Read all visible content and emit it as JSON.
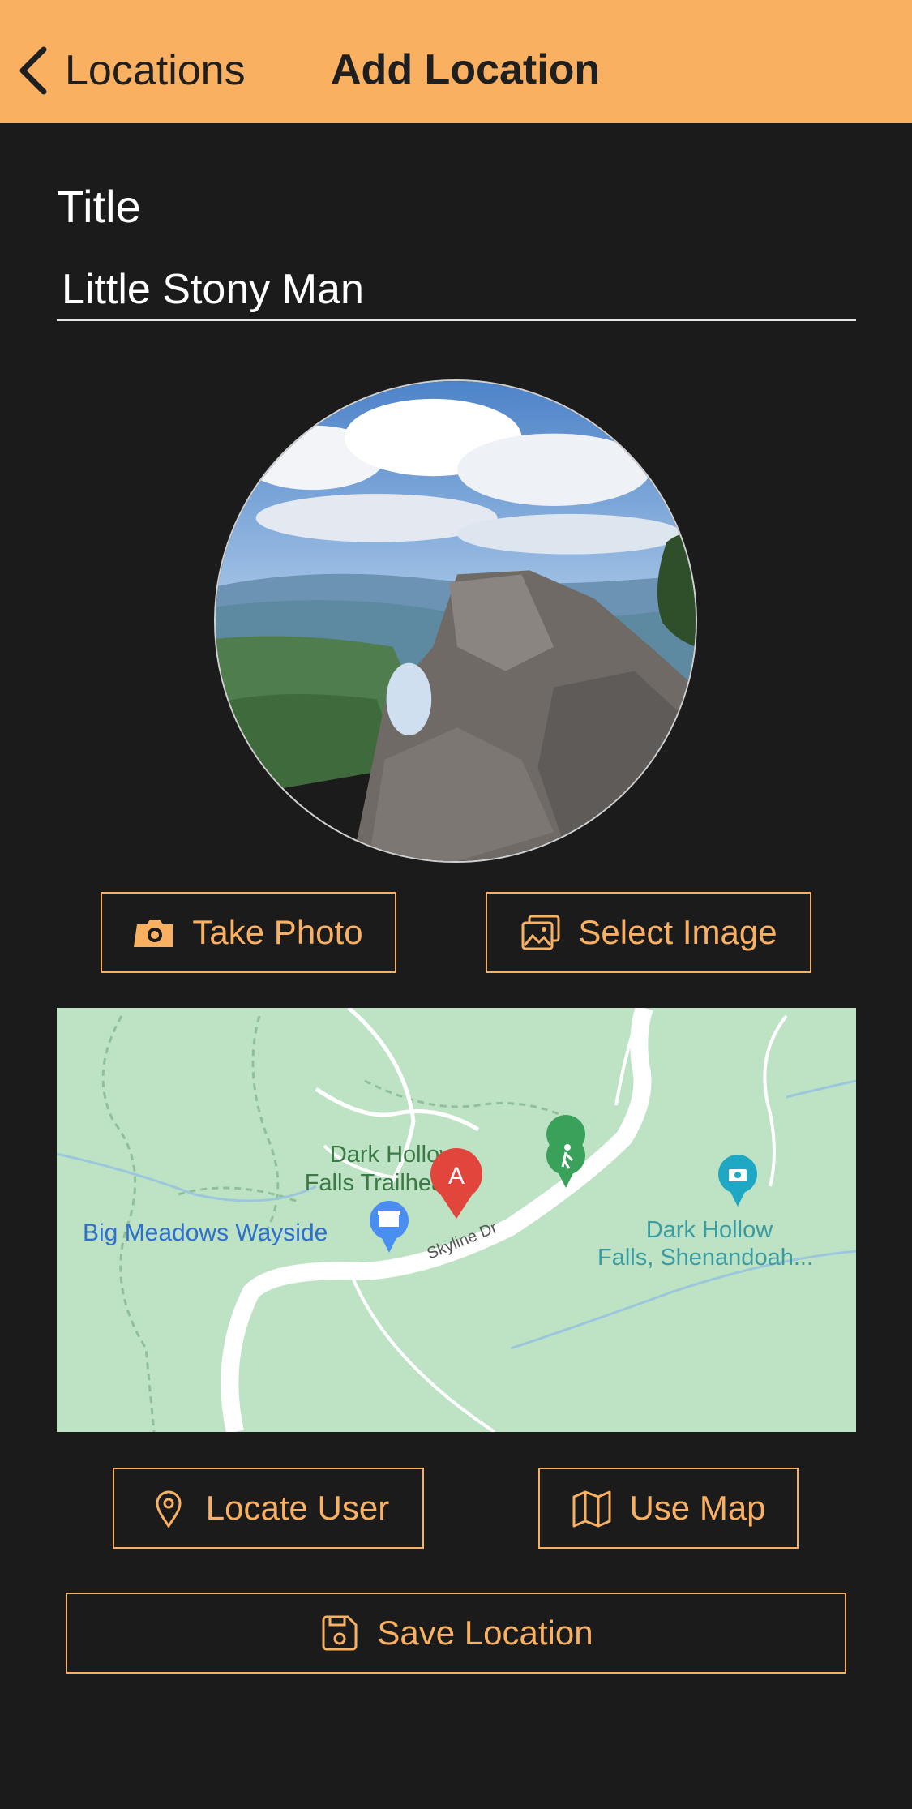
{
  "nav": {
    "back_label": "Locations",
    "title": "Add Location"
  },
  "form": {
    "title_label": "Title",
    "title_value": "Little Stony Man"
  },
  "photo_buttons": {
    "take_photo": "Take Photo",
    "select_image": "Select Image"
  },
  "map": {
    "labels": {
      "trailhead_line1": "Dark Hollow",
      "trailhead_line2": "Falls Trailhead",
      "wayside": "Big Meadows Wayside",
      "falls_line1": "Dark Hollow",
      "falls_line2": "Falls, Shenandoah...",
      "road": "Skyline Dr",
      "marker": "A"
    }
  },
  "location_buttons": {
    "locate_user": "Locate User",
    "use_map": "Use Map"
  },
  "save_label": "Save Location",
  "colors": {
    "accent": "#f9b061",
    "background": "#1b1b1b",
    "map_green": "#bde3c4",
    "marker_red": "#e2453c"
  }
}
